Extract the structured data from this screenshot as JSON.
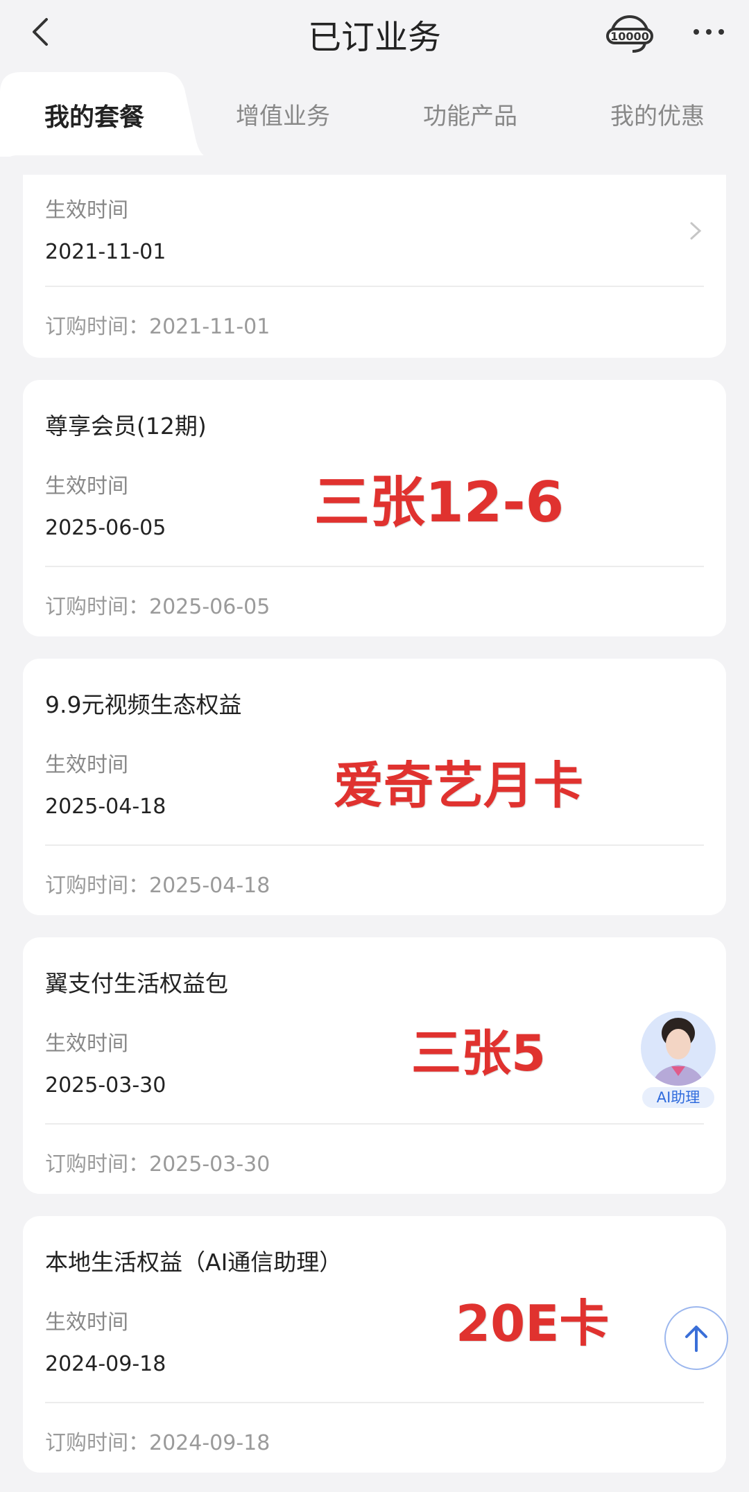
{
  "header": {
    "title": "已订业务"
  },
  "tabs": [
    {
      "label": "我的套餐",
      "active": true
    },
    {
      "label": "增值业务",
      "active": false
    },
    {
      "label": "功能产品",
      "active": false
    },
    {
      "label": "我的优惠",
      "active": false
    }
  ],
  "cards": [
    {
      "effective_label": "生效时间",
      "effective_date": "2021-11-01",
      "order_time": "订购时间：2021-11-01"
    },
    {
      "name": "尊享会员(12期)",
      "effective_label": "生效时间",
      "effective_date": "2025-06-05",
      "order_time": "订购时间：2025-06-05",
      "note": "三张12-6"
    },
    {
      "name": "9.9元视频生态权益",
      "effective_label": "生效时间",
      "effective_date": "2025-04-18",
      "order_time": "订购时间：2025-04-18",
      "note": "爱奇艺月卡"
    },
    {
      "name": "翼支付生活权益包",
      "effective_label": "生效时间",
      "effective_date": "2025-03-30",
      "order_time": "订购时间：2025-03-30",
      "note": "三张5"
    },
    {
      "name": "本地生活权益（AI通信助理）",
      "effective_label": "生效时间",
      "effective_date": "2024-09-18",
      "order_time": "订购时间：2024-09-18",
      "note": "20E卡"
    }
  ],
  "assistant": {
    "label": "AI助理"
  },
  "icons": {
    "back": "chevron-left-icon",
    "hotline": "headset-10000-icon",
    "more": "more-dots-icon",
    "scroll_top": "arrow-up-icon"
  },
  "colors": {
    "note": "#e0322f",
    "accent": "#2f6bdd"
  }
}
